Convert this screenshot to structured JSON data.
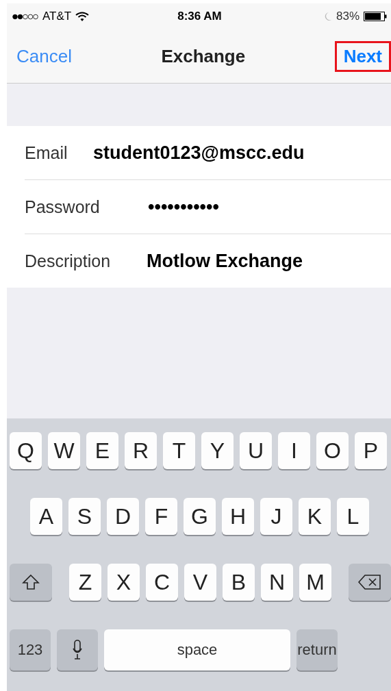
{
  "status_bar": {
    "carrier": "AT&T",
    "time": "8:36 AM",
    "battery_percent": "83%"
  },
  "nav_bar": {
    "cancel": "Cancel",
    "title": "Exchange",
    "next": {
      "label": "Next",
      "highlighted": true
    }
  },
  "fields": [
    {
      "label": "Email",
      "value": "student0123@mscc.edu"
    },
    {
      "label": "Password",
      "value": "•••••••••••"
    },
    {
      "label": "Description",
      "value": "Motlow Exchange"
    }
  ],
  "keyboard": {
    "rows": [
      [
        "Q",
        "W",
        "E",
        "R",
        "T",
        "Y",
        "U",
        "I",
        "O",
        "P"
      ],
      [
        "A",
        "S",
        "D",
        "F",
        "G",
        "H",
        "J",
        "K",
        "L"
      ],
      [
        "Z",
        "X",
        "C",
        "V",
        "B",
        "N",
        "M"
      ]
    ],
    "numbers_key": "123",
    "space_key": "space",
    "return_key": "return"
  }
}
